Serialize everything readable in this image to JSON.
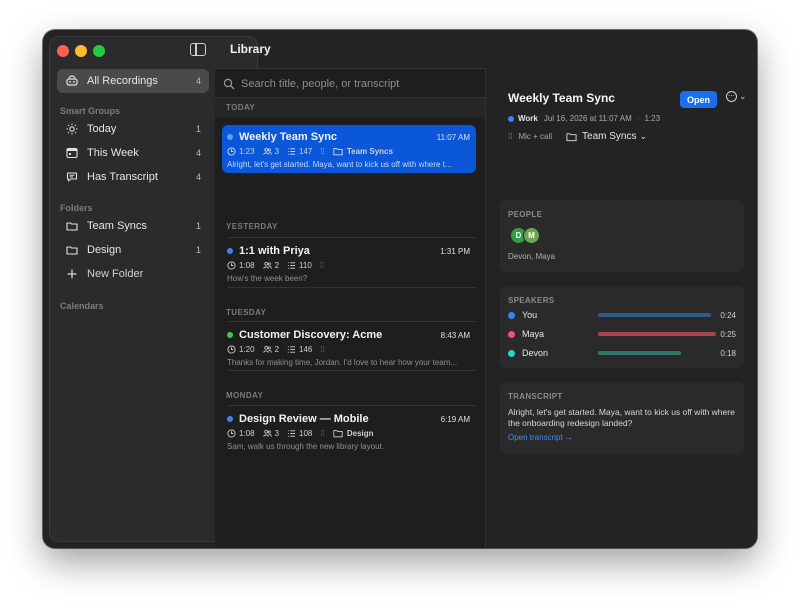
{
  "window": {
    "title": "Library"
  },
  "sidebar": {
    "all": {
      "label": "All Recordings",
      "count": "4"
    },
    "smart_groups_label": "Smart Groups",
    "smart_groups": [
      {
        "label": "Today",
        "count": "1",
        "icon": "sun-icon"
      },
      {
        "label": "This Week",
        "count": "4",
        "icon": "calendar-icon"
      },
      {
        "label": "Has Transcript",
        "count": "4",
        "icon": "speech-bubble-icon"
      }
    ],
    "folders_label": "Folders",
    "folders": [
      {
        "label": "Team Syncs",
        "count": "1",
        "icon": "folder-icon"
      },
      {
        "label": "Design",
        "count": "1",
        "icon": "folder-icon"
      }
    ],
    "new_folder": "New Folder",
    "calendars_label": "Calendars"
  },
  "search": {
    "placeholder": "Search title, people, or transcript"
  },
  "sections": {
    "today": "TODAY",
    "yesterday": "YESTERDAY",
    "tuesday": "TUESDAY",
    "monday": "MONDAY"
  },
  "recordings": [
    {
      "title": "Weekly Team Sync",
      "time": "11:07 AM",
      "duration": "1:23",
      "people": "3",
      "words": "147",
      "folder": "Team Syncs",
      "snippet": "Alright, let's get started. Maya, want to kick us off with where t...",
      "dot_color": "#5aa0ff"
    },
    {
      "title": "1:1 with Priya",
      "time": "1:31 PM",
      "duration": "1:08",
      "people": "2",
      "words": "110",
      "folder": "",
      "snippet": "How's the week been?",
      "dot_color": "#3b82f6"
    },
    {
      "title": "Customer Discovery: Acme",
      "time": "8:43 AM",
      "duration": "1:20",
      "people": "2",
      "words": "146",
      "folder": "",
      "snippet": "Thanks for making time, Jordan. I'd love to hear how your team...",
      "dot_color": "#34c759"
    },
    {
      "title": "Design Review — Mobile",
      "time": "6:19 AM",
      "duration": "1:08",
      "people": "3",
      "words": "108",
      "folder": "Design",
      "snippet": "Sam, walk us through the new library layout.",
      "dot_color": "#3b82f6"
    }
  ],
  "detail": {
    "title": "Weekly Team Sync",
    "open_label": "Open",
    "category": "Work",
    "category_color": "#3b82f6",
    "date": "Jul 16, 2026 at 11:07 AM",
    "duration": "1:23",
    "source": "Mic + call",
    "folder": "Team Syncs",
    "people_label": "PEOPLE",
    "people_names": "Devon, Maya",
    "avatars": [
      {
        "initial": "D",
        "color": "#2f9e44"
      },
      {
        "initial": "M",
        "color": "#6aa84f"
      }
    ],
    "speakers_label": "SPEAKERS",
    "speakers": [
      {
        "name": "You",
        "duration": "0:24",
        "color": "#3b82f6",
        "bar_color": "#2d5a8c",
        "share": 0.96
      },
      {
        "name": "Maya",
        "duration": "0:25",
        "color": "#ff4d6d",
        "bar_color": "#a8424e",
        "share": 1.0
      },
      {
        "name": "Devon",
        "duration": "0:18",
        "color": "#2dd4bf",
        "bar_color": "#2e7a6a",
        "share": 0.7
      }
    ],
    "transcript_label": "TRANSCRIPT",
    "transcript_text": "Alright, let's get started. Maya, want to kick us off with where the onboarding redesign landed?",
    "transcript_link": "Open transcript →"
  }
}
